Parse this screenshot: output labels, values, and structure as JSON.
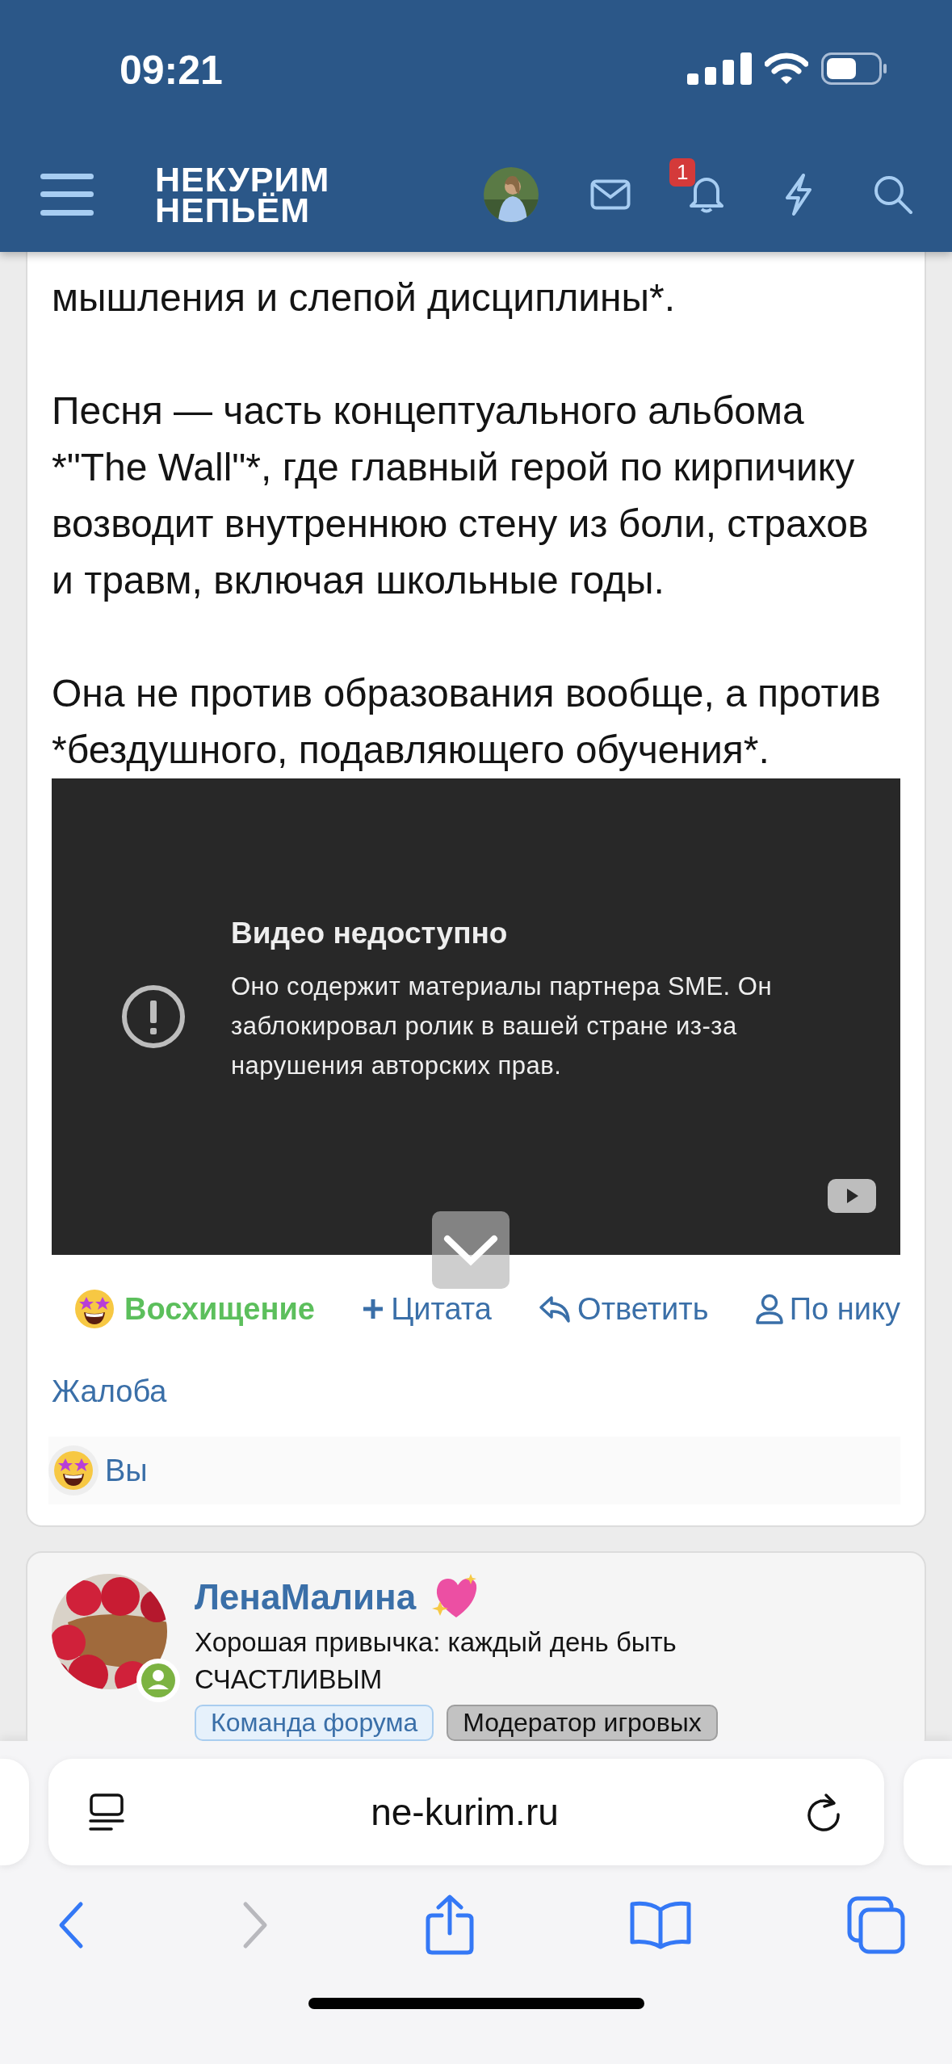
{
  "status_bar": {
    "time": "09:21"
  },
  "header": {
    "logo": [
      "НЕКУРИМ",
      "НЕПЬЁМ"
    ],
    "notification_badge": "1"
  },
  "post": {
    "paragraphs": [
      "мышления и слепой дисциплины*.",
      "Песня — часть концептуального альбома *\"The Wall\"*, где главный герой по кирпичику возводит внутреннюю стену из боли, страхов и травм, включая школьные годы.",
      "Она не против образования вообще, а против *бездушного, подавляющего обучения*."
    ],
    "video": {
      "title": "Видео недоступно",
      "message": "Оно содержит материалы партнера SME. Он заблокировал ролик в вашей стране из-за нарушения авторских прав."
    },
    "actions": [
      {
        "kind": "reaction",
        "label": "Восхищение"
      },
      {
        "kind": "quote",
        "label": "Цитата"
      },
      {
        "kind": "reply",
        "label": "Ответить"
      },
      {
        "kind": "mention",
        "label": "По нику"
      },
      {
        "kind": "report",
        "label": "Жалоба"
      }
    ],
    "reactions": {
      "users": "Вы"
    }
  },
  "next_post": {
    "author": "ЛенаМалина",
    "online": true,
    "status": "Хорошая привычка: каждый день быть СЧАСТЛИВЫМ",
    "badges": [
      {
        "kind": "team",
        "label": "Команда форума"
      },
      {
        "kind": "moderator",
        "label": "Модератор игровых"
      }
    ]
  },
  "browser": {
    "url": "ne-kurim.ru",
    "forward_disabled": true
  }
}
